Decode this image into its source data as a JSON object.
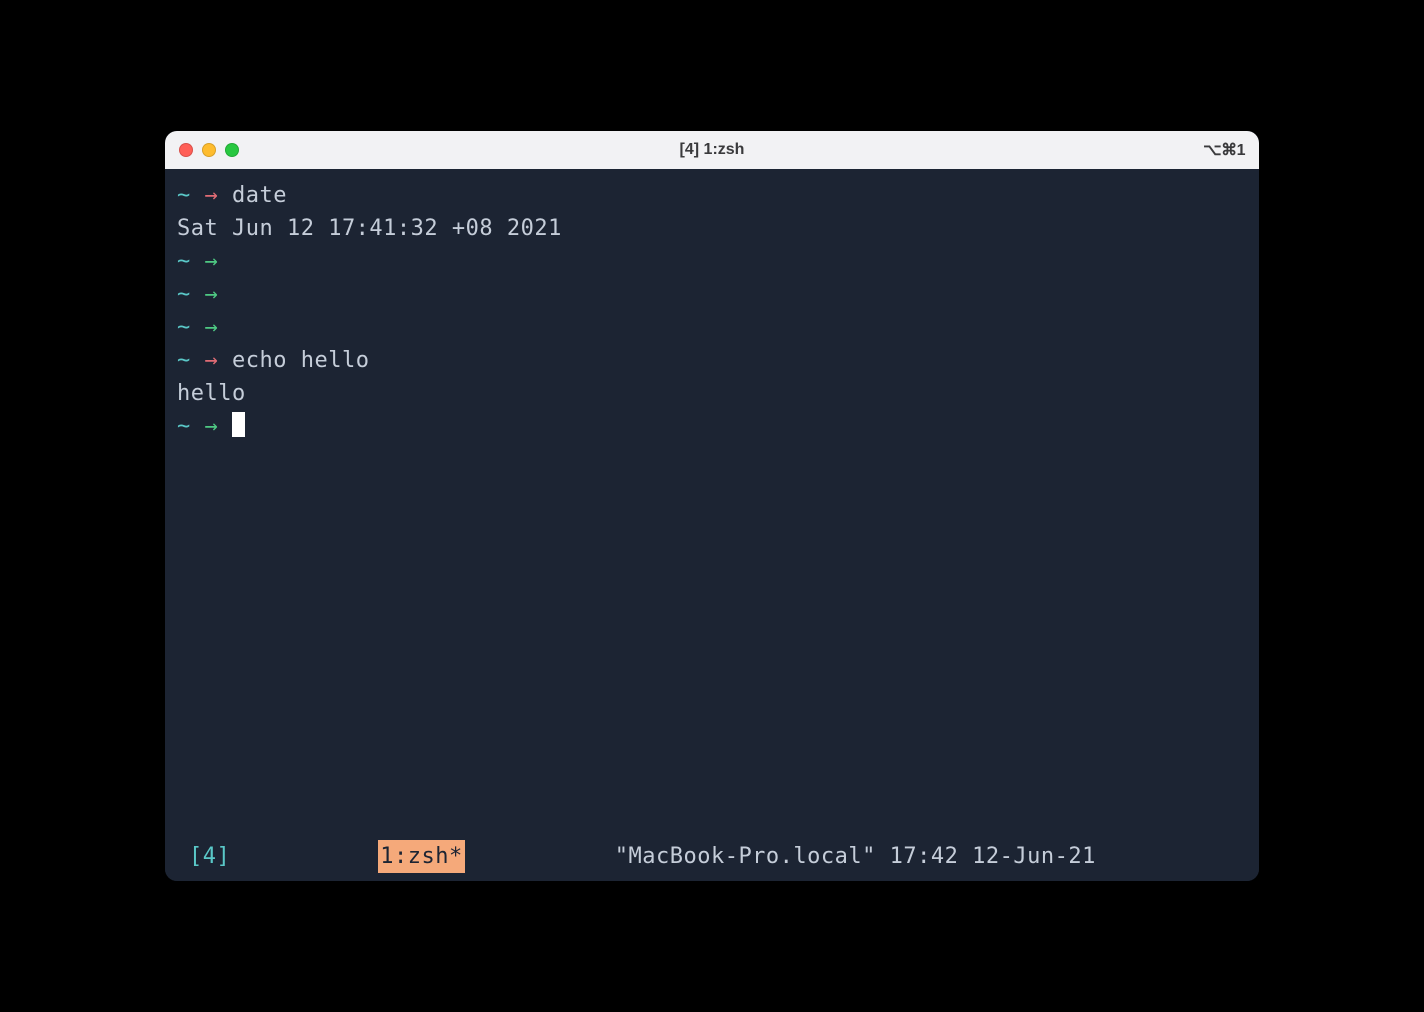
{
  "titlebar": {
    "title": "[4] 1:zsh",
    "shortcut": "⌥⌘1"
  },
  "lines": [
    {
      "type": "prompt",
      "arrow": "red",
      "cmd": "date"
    },
    {
      "type": "output",
      "text": "Sat Jun 12 17:41:32 +08 2021"
    },
    {
      "type": "prompt",
      "arrow": "green",
      "cmd": ""
    },
    {
      "type": "prompt",
      "arrow": "green",
      "cmd": ""
    },
    {
      "type": "prompt",
      "arrow": "green",
      "cmd": ""
    },
    {
      "type": "prompt",
      "arrow": "red",
      "cmd": "echo hello"
    },
    {
      "type": "output",
      "text": "hello"
    },
    {
      "type": "prompt",
      "arrow": "green",
      "cmd": "",
      "cursor": true
    }
  ],
  "status": {
    "session": "[4]",
    "window": "1:zsh*",
    "host": "\"MacBook-Pro.local\" 17:42 12-Jun-21"
  }
}
